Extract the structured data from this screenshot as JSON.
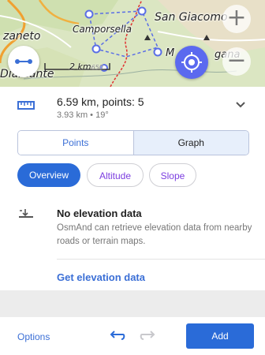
{
  "map": {
    "labels": {
      "san_giacomo": "San Giacomo",
      "camporsella": "Camporsella",
      "zaneto": "zaneto",
      "diamante": "Diamante",
      "mgana": "M",
      "gana_suffix": "gana"
    },
    "scale_text": "2 km",
    "scale_extra": "650",
    "zoom_in": "+",
    "zoom_out": "−"
  },
  "measure": {
    "title": "6.59 km, points: 5",
    "subtitle": "3.93 km • 19°",
    "icon": "ruler-icon",
    "expand_icon": "chevron-down-icon"
  },
  "tabs": [
    {
      "label": "Points",
      "selected": false
    },
    {
      "label": "Graph",
      "selected": true
    }
  ],
  "chips": [
    {
      "label": "Overview",
      "selected": true
    },
    {
      "label": "Altitude",
      "selected": false
    },
    {
      "label": "Slope",
      "selected": false
    }
  ],
  "elevation": {
    "icon": "elevation-icon",
    "title": "No elevation data",
    "description": "OsmAnd can retrieve elevation data from nearby roads or terrain maps.",
    "action": "Get elevation data"
  },
  "bottom_bar": {
    "options": "Options",
    "undo_icon": "undo-icon",
    "redo_icon": "redo-icon",
    "add": "Add"
  },
  "colors": {
    "accent": "#2a6bd8",
    "fab": "#5b69ef",
    "route": "#5a6ee6",
    "border": "#d33030"
  }
}
